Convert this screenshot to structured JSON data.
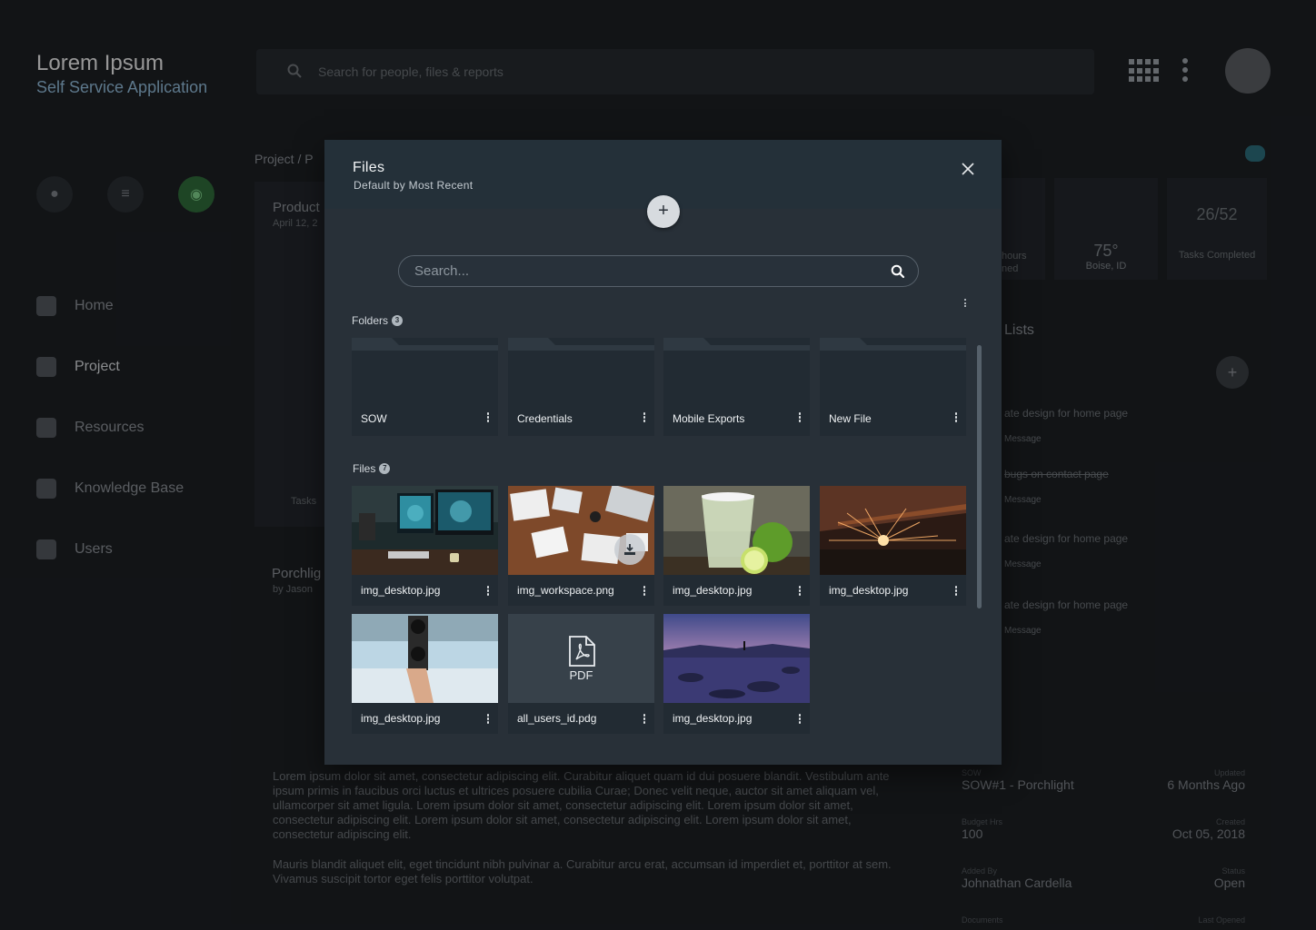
{
  "app": {
    "title": "Lorem Ipsum",
    "subtitle": "Self Service Application",
    "search_placeholder": "Search for people, files & reports"
  },
  "sidebar": {
    "items": [
      {
        "label": "Home",
        "icon": "home-icon"
      },
      {
        "label": "Project",
        "icon": "person-icon",
        "active": true
      },
      {
        "label": "Resources",
        "icon": "compass-icon"
      },
      {
        "label": "Knowledge Base",
        "icon": "download-icon"
      },
      {
        "label": "Users",
        "icon": "gear-icon"
      }
    ]
  },
  "breadcrumb": "Project  /  P",
  "background": {
    "product_title": "Product",
    "product_date": "April 12, 2",
    "porchlight_title": "Porchlig",
    "porchlight_by": "by Jason",
    "tasks_label": "Tasks",
    "paragraph1": "Lorem ipsum dolor sit amet, consectetur adipiscing elit. Curabitur aliquet quam id dui posuere blandit. Vestibulum ante ipsum primis in faucibus orci luctus et ultrices posuere cubilia Curae; Donec velit neque, auctor sit amet aliquam vel, ullamcorper sit amet ligula. Lorem ipsum dolor sit amet, consectetur adipiscing elit. Lorem ipsum dolor sit amet, consectetur adipiscing elit. Lorem ipsum dolor sit amet, consectetur adipiscing elit. Lorem ipsum dolor sit amet, consectetur adipiscing elit.",
    "paragraph2": "Mauris blandit aliquet elit, eget tincidunt nibh pulvinar a. Curabitur arcu erat, accumsan id imperdiet et, porttitor at sem. Vivamus suscipit tortor eget felis porttitor volutpat.",
    "weather_temp": "75°",
    "weather_loc": "Boise, ID",
    "tasks_count": "26/52",
    "tasks_completed": "Tasks Completed",
    "hours_label": "hours",
    "hours_sub": "ned",
    "lists_title": "Lists",
    "list_items": [
      {
        "title": "ate design for home page",
        "sub": "Message"
      },
      {
        "title": "bugs on contact page",
        "sub": "Message"
      },
      {
        "title": "ate design for home page",
        "sub": "Message"
      },
      {
        "title": "ate design for home page",
        "sub": "Message"
      }
    ],
    "info": [
      {
        "label": "SOW",
        "value": "SOW#1 - Porchlight",
        "rlabel": "Updated",
        "rvalue": "6 Months Ago"
      },
      {
        "label": "Budget Hrs",
        "value": "100",
        "rlabel": "Created",
        "rvalue": "Oct 05, 2018"
      },
      {
        "label": "Added By",
        "value": "Johnathan Cardella",
        "rlabel": "Status",
        "rvalue": "Open"
      },
      {
        "label": "Documents",
        "value": "",
        "rlabel": "Last Opened",
        "rvalue": ""
      }
    ]
  },
  "modal": {
    "title": "Files",
    "subtitle": "Default by Most Recent",
    "add_label": "+",
    "search_placeholder": "Search...",
    "folders_label": "Folders",
    "folders_count": "3",
    "files_label": "Files",
    "files_count": "7",
    "folders": [
      {
        "name": "SOW"
      },
      {
        "name": "Credentials"
      },
      {
        "name": "Mobile Exports"
      },
      {
        "name": "New File"
      }
    ],
    "files": [
      {
        "name": "img_desktop.jpg",
        "thumb": "desk"
      },
      {
        "name": "img_workspace.png",
        "thumb": "workspace"
      },
      {
        "name": "img_desktop.jpg",
        "thumb": "drink"
      },
      {
        "name": "img_desktop.jpg",
        "thumb": "sparks"
      },
      {
        "name": "img_desktop.jpg",
        "thumb": "camera"
      },
      {
        "name": "all_users_id.pdg",
        "thumb": "pdf",
        "pdf_label": "PDF"
      },
      {
        "name": "img_desktop.jpg",
        "thumb": "lake"
      }
    ]
  },
  "colors": {
    "modal_bg": "#283038",
    "modal_header": "#243039",
    "card_bg": "#222b33",
    "accent_green": "#2f6b3a"
  }
}
